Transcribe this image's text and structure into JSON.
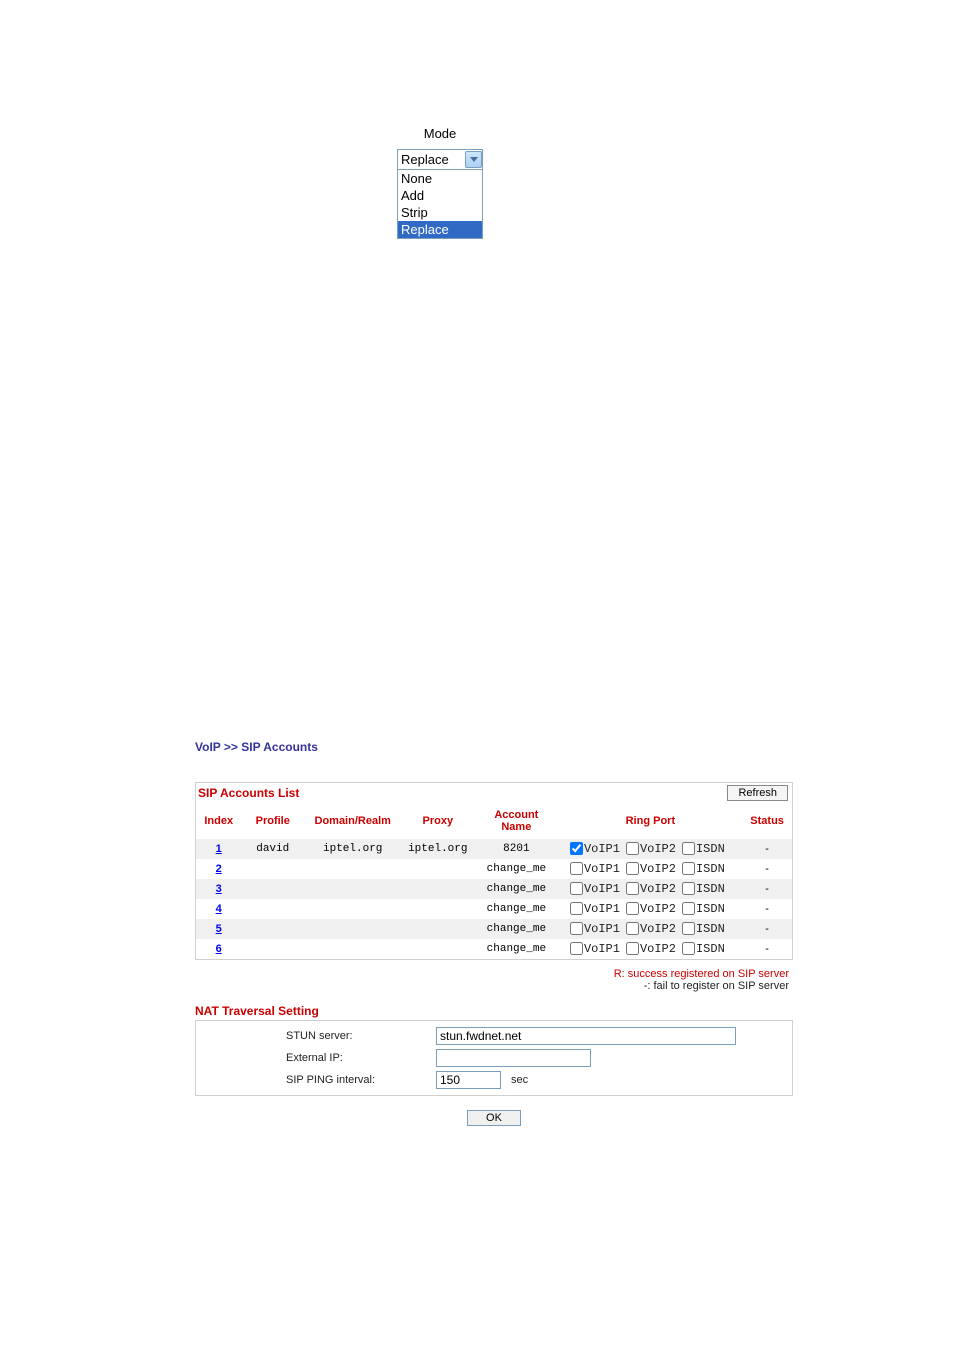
{
  "mode": {
    "label": "Mode",
    "selected": "Replace",
    "options": [
      "None",
      "Add",
      "Strip",
      "Replace"
    ]
  },
  "breadcrumb": "VoIP >> SIP Accounts",
  "sip_list": {
    "title": "SIP Accounts List",
    "refresh": "Refresh",
    "headers": {
      "index": "Index",
      "profile": "Profile",
      "domain": "Domain/Realm",
      "proxy": "Proxy",
      "account": "Account Name",
      "ringport": "Ring Port",
      "status": "Status"
    },
    "ring_labels": {
      "voip1": "VoIP1",
      "voip2": "VoIP2",
      "isdn": "ISDN"
    },
    "rows": [
      {
        "index": "1",
        "profile": "david",
        "domain": "iptel.org",
        "proxy": "iptel.org",
        "account": "8201",
        "voip1": true,
        "voip2": false,
        "isdn": false,
        "status": "-"
      },
      {
        "index": "2",
        "profile": "",
        "domain": "",
        "proxy": "",
        "account": "change_me",
        "voip1": false,
        "voip2": false,
        "isdn": false,
        "status": "-"
      },
      {
        "index": "3",
        "profile": "",
        "domain": "",
        "proxy": "",
        "account": "change_me",
        "voip1": false,
        "voip2": false,
        "isdn": false,
        "status": "-"
      },
      {
        "index": "4",
        "profile": "",
        "domain": "",
        "proxy": "",
        "account": "change_me",
        "voip1": false,
        "voip2": false,
        "isdn": false,
        "status": "-"
      },
      {
        "index": "5",
        "profile": "",
        "domain": "",
        "proxy": "",
        "account": "change_me",
        "voip1": false,
        "voip2": false,
        "isdn": false,
        "status": "-"
      },
      {
        "index": "6",
        "profile": "",
        "domain": "",
        "proxy": "",
        "account": "change_me",
        "voip1": false,
        "voip2": false,
        "isdn": false,
        "status": "-"
      }
    ]
  },
  "legend": {
    "success": "R: success registered on SIP server",
    "fail": "-: fail to register on SIP server"
  },
  "nat": {
    "title": "NAT Traversal Setting",
    "stun_label": "STUN server:",
    "stun_value": "stun.fwdnet.net",
    "ext_label": "External IP:",
    "ext_value": "",
    "ping_label": "SIP PING interval:",
    "ping_value": "150",
    "ping_unit": "sec"
  },
  "ok": "OK"
}
